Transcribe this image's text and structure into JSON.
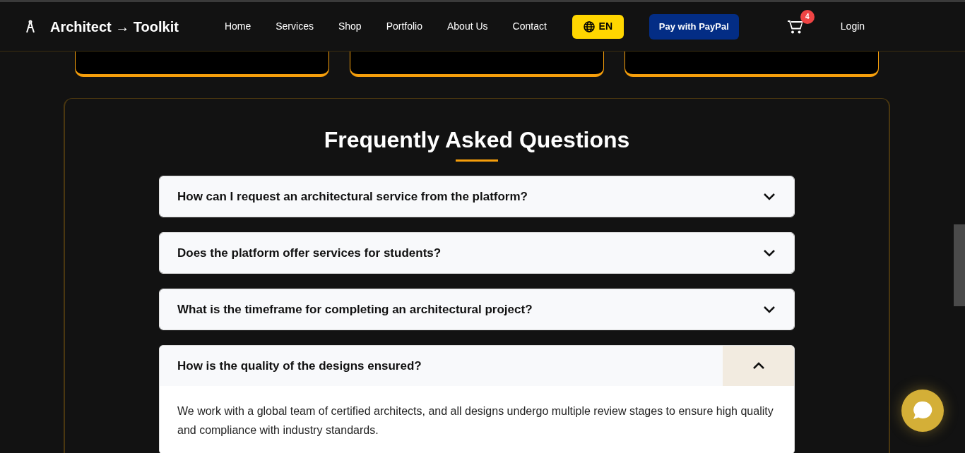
{
  "brand": {
    "title": "Architect → Toolkit"
  },
  "nav": [
    {
      "label": "Home"
    },
    {
      "label": "Services"
    },
    {
      "label": "Shop"
    },
    {
      "label": "Portfolio"
    },
    {
      "label": "About Us"
    },
    {
      "label": "Contact"
    }
  ],
  "language_button": {
    "label": "EN"
  },
  "paypal_button": {
    "label": "Pay with PayPal"
  },
  "cart": {
    "count": "4"
  },
  "login": {
    "label": "Login"
  },
  "faq": {
    "title": "Frequently Asked Questions",
    "items": [
      {
        "question": "How can I request an architectural service from the platform?",
        "expanded": false
      },
      {
        "question": "Does the platform offer services for students?",
        "expanded": false
      },
      {
        "question": "What is the timeframe for completing an architectural project?",
        "expanded": false
      },
      {
        "question": "How is the quality of the designs ensured?",
        "expanded": true,
        "answer": "We work with a global team of certified architects, and all designs undergo multiple review stages to ensure high quality and compliance with industry standards."
      }
    ]
  }
}
